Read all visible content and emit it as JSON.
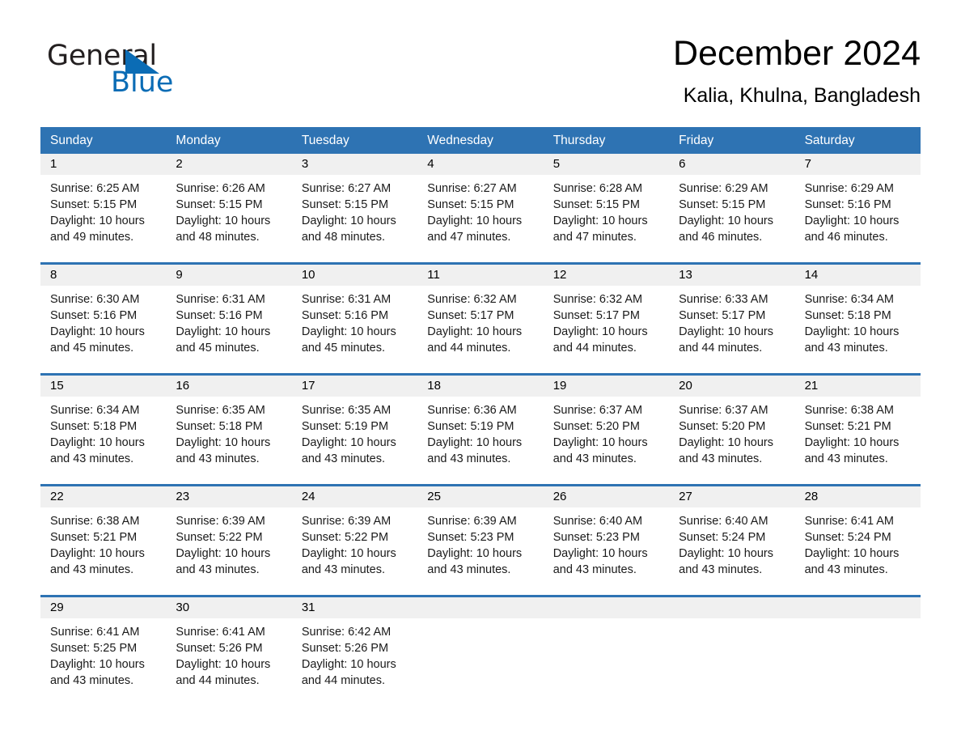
{
  "brand": {
    "name_part1": "General",
    "name_part2": "Blue",
    "logo_icon": "triangle-logo-icon",
    "accent_color": "#0b6cb5"
  },
  "header": {
    "month_title": "December 2024",
    "location": "Kalia, Khulna, Bangladesh"
  },
  "colors": {
    "header_blue": "#2e73b3",
    "daynum_band": "#f0f0f0",
    "brand_blue": "#0b6cb5"
  },
  "calendar": {
    "weekdays": [
      "Sunday",
      "Monday",
      "Tuesday",
      "Wednesday",
      "Thursday",
      "Friday",
      "Saturday"
    ],
    "weeks": [
      [
        {
          "day": "1",
          "sunrise": "Sunrise: 6:25 AM",
          "sunset": "Sunset: 5:15 PM",
          "daylight": "Daylight: 10 hours and 49 minutes."
        },
        {
          "day": "2",
          "sunrise": "Sunrise: 6:26 AM",
          "sunset": "Sunset: 5:15 PM",
          "daylight": "Daylight: 10 hours and 48 minutes."
        },
        {
          "day": "3",
          "sunrise": "Sunrise: 6:27 AM",
          "sunset": "Sunset: 5:15 PM",
          "daylight": "Daylight: 10 hours and 48 minutes."
        },
        {
          "day": "4",
          "sunrise": "Sunrise: 6:27 AM",
          "sunset": "Sunset: 5:15 PM",
          "daylight": "Daylight: 10 hours and 47 minutes."
        },
        {
          "day": "5",
          "sunrise": "Sunrise: 6:28 AM",
          "sunset": "Sunset: 5:15 PM",
          "daylight": "Daylight: 10 hours and 47 minutes."
        },
        {
          "day": "6",
          "sunrise": "Sunrise: 6:29 AM",
          "sunset": "Sunset: 5:15 PM",
          "daylight": "Daylight: 10 hours and 46 minutes."
        },
        {
          "day": "7",
          "sunrise": "Sunrise: 6:29 AM",
          "sunset": "Sunset: 5:16 PM",
          "daylight": "Daylight: 10 hours and 46 minutes."
        }
      ],
      [
        {
          "day": "8",
          "sunrise": "Sunrise: 6:30 AM",
          "sunset": "Sunset: 5:16 PM",
          "daylight": "Daylight: 10 hours and 45 minutes."
        },
        {
          "day": "9",
          "sunrise": "Sunrise: 6:31 AM",
          "sunset": "Sunset: 5:16 PM",
          "daylight": "Daylight: 10 hours and 45 minutes."
        },
        {
          "day": "10",
          "sunrise": "Sunrise: 6:31 AM",
          "sunset": "Sunset: 5:16 PM",
          "daylight": "Daylight: 10 hours and 45 minutes."
        },
        {
          "day": "11",
          "sunrise": "Sunrise: 6:32 AM",
          "sunset": "Sunset: 5:17 PM",
          "daylight": "Daylight: 10 hours and 44 minutes."
        },
        {
          "day": "12",
          "sunrise": "Sunrise: 6:32 AM",
          "sunset": "Sunset: 5:17 PM",
          "daylight": "Daylight: 10 hours and 44 minutes."
        },
        {
          "day": "13",
          "sunrise": "Sunrise: 6:33 AM",
          "sunset": "Sunset: 5:17 PM",
          "daylight": "Daylight: 10 hours and 44 minutes."
        },
        {
          "day": "14",
          "sunrise": "Sunrise: 6:34 AM",
          "sunset": "Sunset: 5:18 PM",
          "daylight": "Daylight: 10 hours and 43 minutes."
        }
      ],
      [
        {
          "day": "15",
          "sunrise": "Sunrise: 6:34 AM",
          "sunset": "Sunset: 5:18 PM",
          "daylight": "Daylight: 10 hours and 43 minutes."
        },
        {
          "day": "16",
          "sunrise": "Sunrise: 6:35 AM",
          "sunset": "Sunset: 5:18 PM",
          "daylight": "Daylight: 10 hours and 43 minutes."
        },
        {
          "day": "17",
          "sunrise": "Sunrise: 6:35 AM",
          "sunset": "Sunset: 5:19 PM",
          "daylight": "Daylight: 10 hours and 43 minutes."
        },
        {
          "day": "18",
          "sunrise": "Sunrise: 6:36 AM",
          "sunset": "Sunset: 5:19 PM",
          "daylight": "Daylight: 10 hours and 43 minutes."
        },
        {
          "day": "19",
          "sunrise": "Sunrise: 6:37 AM",
          "sunset": "Sunset: 5:20 PM",
          "daylight": "Daylight: 10 hours and 43 minutes."
        },
        {
          "day": "20",
          "sunrise": "Sunrise: 6:37 AM",
          "sunset": "Sunset: 5:20 PM",
          "daylight": "Daylight: 10 hours and 43 minutes."
        },
        {
          "day": "21",
          "sunrise": "Sunrise: 6:38 AM",
          "sunset": "Sunset: 5:21 PM",
          "daylight": "Daylight: 10 hours and 43 minutes."
        }
      ],
      [
        {
          "day": "22",
          "sunrise": "Sunrise: 6:38 AM",
          "sunset": "Sunset: 5:21 PM",
          "daylight": "Daylight: 10 hours and 43 minutes."
        },
        {
          "day": "23",
          "sunrise": "Sunrise: 6:39 AM",
          "sunset": "Sunset: 5:22 PM",
          "daylight": "Daylight: 10 hours and 43 minutes."
        },
        {
          "day": "24",
          "sunrise": "Sunrise: 6:39 AM",
          "sunset": "Sunset: 5:22 PM",
          "daylight": "Daylight: 10 hours and 43 minutes."
        },
        {
          "day": "25",
          "sunrise": "Sunrise: 6:39 AM",
          "sunset": "Sunset: 5:23 PM",
          "daylight": "Daylight: 10 hours and 43 minutes."
        },
        {
          "day": "26",
          "sunrise": "Sunrise: 6:40 AM",
          "sunset": "Sunset: 5:23 PM",
          "daylight": "Daylight: 10 hours and 43 minutes."
        },
        {
          "day": "27",
          "sunrise": "Sunrise: 6:40 AM",
          "sunset": "Sunset: 5:24 PM",
          "daylight": "Daylight: 10 hours and 43 minutes."
        },
        {
          "day": "28",
          "sunrise": "Sunrise: 6:41 AM",
          "sunset": "Sunset: 5:24 PM",
          "daylight": "Daylight: 10 hours and 43 minutes."
        }
      ],
      [
        {
          "day": "29",
          "sunrise": "Sunrise: 6:41 AM",
          "sunset": "Sunset: 5:25 PM",
          "daylight": "Daylight: 10 hours and 43 minutes."
        },
        {
          "day": "30",
          "sunrise": "Sunrise: 6:41 AM",
          "sunset": "Sunset: 5:26 PM",
          "daylight": "Daylight: 10 hours and 44 minutes."
        },
        {
          "day": "31",
          "sunrise": "Sunrise: 6:42 AM",
          "sunset": "Sunset: 5:26 PM",
          "daylight": "Daylight: 10 hours and 44 minutes."
        },
        {
          "day": "",
          "sunrise": "",
          "sunset": "",
          "daylight": ""
        },
        {
          "day": "",
          "sunrise": "",
          "sunset": "",
          "daylight": ""
        },
        {
          "day": "",
          "sunrise": "",
          "sunset": "",
          "daylight": ""
        },
        {
          "day": "",
          "sunrise": "",
          "sunset": "",
          "daylight": ""
        }
      ]
    ]
  }
}
